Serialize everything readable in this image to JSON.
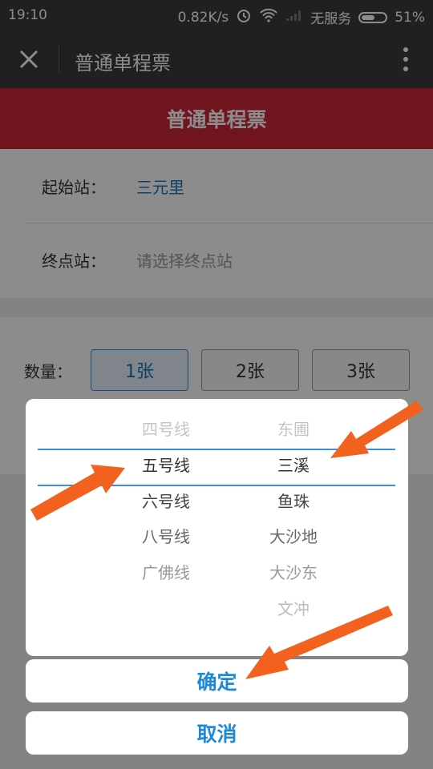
{
  "status_bar": {
    "time": "19:10",
    "speed": "0.82K/s",
    "network": "无服务",
    "battery": "51%"
  },
  "nav": {
    "title": "普通单程票"
  },
  "banner": {
    "title": "普通单程票"
  },
  "form": {
    "start_label": "起始站：",
    "start_value": "三元里",
    "end_label": "终点站：",
    "end_placeholder": "请选择终点站"
  },
  "quantity": {
    "label": "数量：",
    "options": [
      "1张",
      "2张",
      "3张"
    ],
    "selected": "1张"
  },
  "picker": {
    "lines": [
      "四号线",
      "五号线",
      "六号线",
      "八号线",
      "广佛线"
    ],
    "selected_line": "五号线",
    "stations": [
      "东圃",
      "三溪",
      "鱼珠",
      "大沙地",
      "大沙东",
      "文冲"
    ],
    "selected_station": "三溪"
  },
  "actions": {
    "confirm": "确定",
    "cancel": "取消"
  },
  "colors": {
    "banner": "#cc2537",
    "accent": "#1e8ad6",
    "arrow": "#f2611d"
  }
}
